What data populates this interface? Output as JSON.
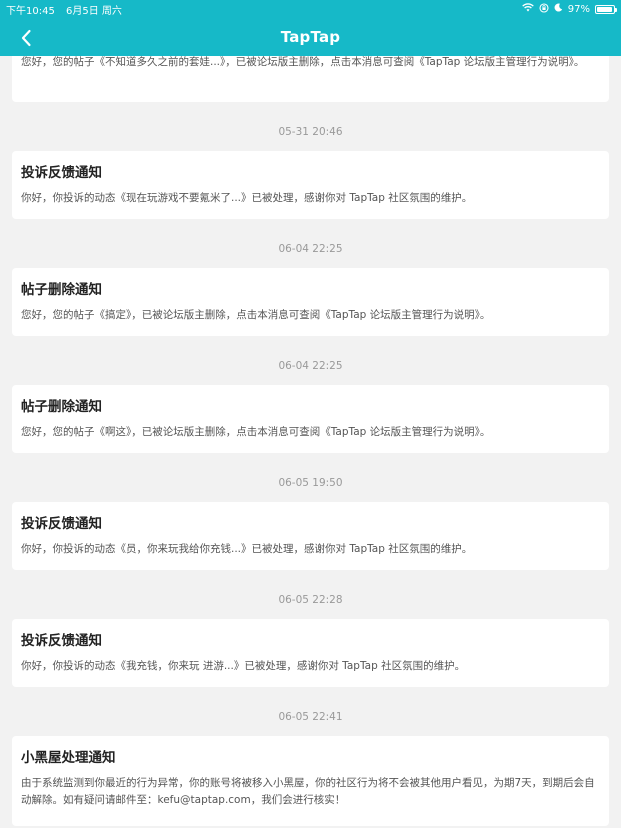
{
  "status_bar": {
    "time": "下午10:45",
    "date": "6月5日 周六",
    "battery": "97%"
  },
  "nav": {
    "title": "TapTap"
  },
  "top_card_body": "您好，您的帖子《不知道多久之前的套娃...》，已被论坛版主删除，点击本消息可查阅《TapTap 论坛版主管理行为说明》。",
  "messages": [
    {
      "time": "05-31 20:46",
      "title": "投诉反馈通知",
      "body": "你好，你投诉的动态《现在玩游戏不要氪米了...》已被处理，感谢你对 TapTap 社区氛围的维护。"
    },
    {
      "time": "06-04 22:25",
      "title": "帖子删除通知",
      "body": "您好，您的帖子《搞定》，已被论坛版主删除，点击本消息可查阅《TapTap 论坛版主管理行为说明》。"
    },
    {
      "time": "06-04 22:25",
      "title": "帖子删除通知",
      "body": "您好，您的帖子《啊这》，已被论坛版主删除，点击本消息可查阅《TapTap 论坛版主管理行为说明》。"
    },
    {
      "time": "06-05 19:50",
      "title": "投诉反馈通知",
      "body": "你好，你投诉的动态《员，你来玩我给你充钱...》已被处理，感谢你对 TapTap 社区氛围的维护。"
    },
    {
      "time": "06-05 22:28",
      "title": "投诉反馈通知",
      "body": "你好，你投诉的动态《我充钱，你来玩 进游...》已被处理，感谢你对 TapTap 社区氛围的维护。"
    },
    {
      "time": "06-05 22:41",
      "title": "小黑屋处理通知",
      "body": "由于系统监测到你最近的行为异常，你的账号将被移入小黑屋，你的社区行为将不会被其他用户看见，为期7天，到期后会自动解除。如有疑问请邮件至：kefu@taptap.com，我们会进行核实！"
    }
  ],
  "colors": {
    "accent": "#16b9c8",
    "background": "#f2f2f2"
  }
}
